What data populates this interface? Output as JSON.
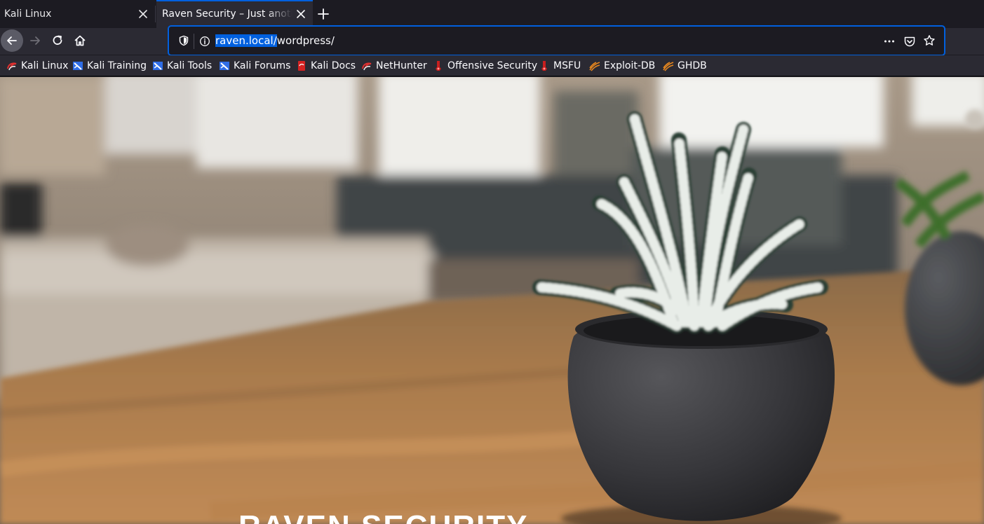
{
  "tabs": [
    {
      "title": "Kali Linux",
      "active": false
    },
    {
      "title": "Raven Security – Just another WordPress site",
      "active": true
    }
  ],
  "navigation": {
    "back": "back-arrow-icon",
    "forward": "forward-arrow-icon",
    "reload": "reload-icon",
    "home": "home-icon"
  },
  "urlbar": {
    "host": "raven.local/",
    "path": "wordpress/",
    "selected_part": "raven.local/"
  },
  "bookmarks": [
    {
      "label": "Kali Linux",
      "icon": "kali-dragon-icon"
    },
    {
      "label": "Kali Training",
      "icon": "kali-training-icon"
    },
    {
      "label": "Kali Tools",
      "icon": "kali-tools-icon"
    },
    {
      "label": "Kali Forums",
      "icon": "kali-forums-icon"
    },
    {
      "label": "Kali Docs",
      "icon": "kali-docs-icon"
    },
    {
      "label": "NetHunter",
      "icon": "nethunter-icon"
    },
    {
      "label": "Offensive Security",
      "icon": "offsec-icon"
    },
    {
      "label": "MSFU",
      "icon": "msfu-icon"
    },
    {
      "label": "Exploit-DB",
      "icon": "exploit-db-icon"
    },
    {
      "label": "GHDB",
      "icon": "ghdb-icon"
    }
  ],
  "page": {
    "site_title": "RAVEN SECURITY",
    "hero_image": "succulent plant in dark pot on wooden desk"
  },
  "colors": {
    "accent": "#0060df",
    "toolbar": "#2b2a33",
    "tabstrip": "#1c1b22"
  }
}
